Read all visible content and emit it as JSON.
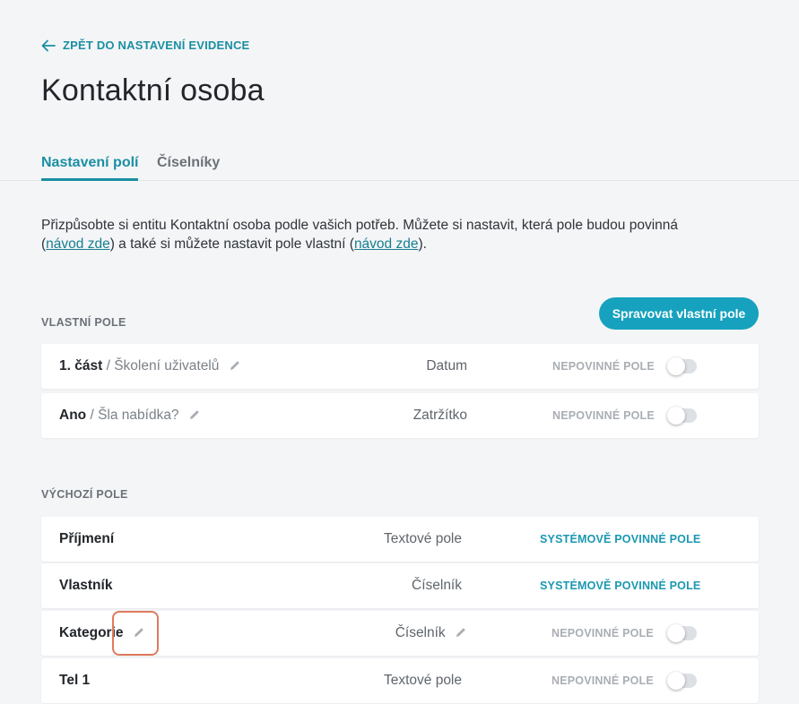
{
  "nav": {
    "back_label": "ZPĚT DO NASTAVENÍ EVIDENCE"
  },
  "page": {
    "title": "Kontaktní osoba"
  },
  "tabs": [
    {
      "label": "Nastavení polí",
      "active": true
    },
    {
      "label": "Číselníky",
      "active": false
    }
  ],
  "intro": {
    "text1": "Přizpůsobte si entitu Kontaktní osoba podle vašich potřeb. Můžete si nastavit, která pole budou povinná (",
    "link1": "návod zde",
    "text2": ") a také si můžete nastavit pole vlastní (",
    "link2": "návod zde",
    "text3": ")."
  },
  "custom_fields": {
    "label": "VLASTNÍ POLE",
    "manage_button": "Spravovat vlastní pole",
    "rows": [
      {
        "name": "1. část",
        "subtitle": "/ Školení uživatelů",
        "type": "Datum",
        "status": "NEPOVINNÉ POLE",
        "toggle_on": false
      },
      {
        "name": "Ano",
        "subtitle": "/ Šla nabídka?",
        "type": "Zatržítko",
        "status": "NEPOVINNÉ POLE",
        "toggle_on": false
      }
    ]
  },
  "default_fields": {
    "label": "VÝCHOZÍ POLE",
    "rows": [
      {
        "name": "Příjmení",
        "type": "Textové pole",
        "status": "SYSTÉMOVĚ POVINNÉ POLE"
      },
      {
        "name": "Vlastník",
        "type": "Číselník",
        "status": "SYSTÉMOVĚ POVINNÉ POLE"
      },
      {
        "name": "Kategorie",
        "type": "Číselník",
        "status": "NEPOVINNÉ POLE",
        "toggle_on": false
      },
      {
        "name": "Tel 1",
        "type": "Textové pole",
        "status": "NEPOVINNÉ POLE",
        "toggle_on": false
      }
    ]
  },
  "colors": {
    "accent": "#16a2be",
    "link": "#1a8fa3",
    "highlight": "#e07a5f"
  }
}
